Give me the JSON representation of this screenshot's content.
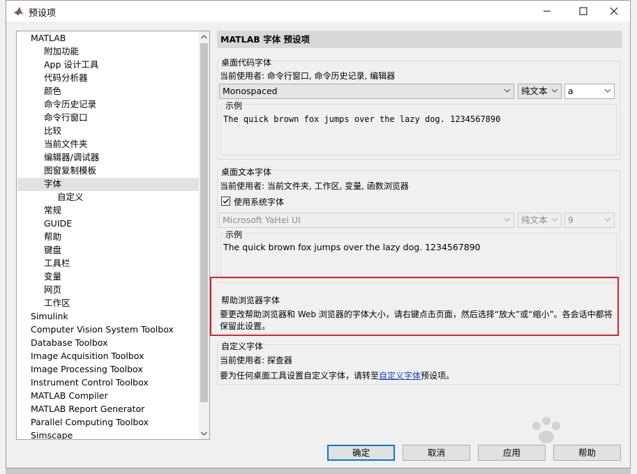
{
  "window": {
    "title": "预设项"
  },
  "tree": {
    "items": [
      {
        "label": "MATLAB",
        "level": 0
      },
      {
        "label": "附加功能",
        "level": 1
      },
      {
        "label": "App 设计工具",
        "level": 1
      },
      {
        "label": "代码分析器",
        "level": 1
      },
      {
        "label": "颜色",
        "level": 1
      },
      {
        "label": "命令历史记录",
        "level": 1
      },
      {
        "label": "命令行窗口",
        "level": 1
      },
      {
        "label": "比较",
        "level": 1
      },
      {
        "label": "当前文件夹",
        "level": 1
      },
      {
        "label": "编辑器/调试器",
        "level": 1
      },
      {
        "label": "图窗复制模板",
        "level": 1
      },
      {
        "label": "字体",
        "level": 1,
        "selected": true
      },
      {
        "label": "自定义",
        "level": 2
      },
      {
        "label": "常规",
        "level": 1
      },
      {
        "label": "GUIDE",
        "level": 1
      },
      {
        "label": "帮助",
        "level": 1
      },
      {
        "label": "键盘",
        "level": 1
      },
      {
        "label": "工具栏",
        "level": 1
      },
      {
        "label": "变量",
        "level": 1
      },
      {
        "label": "网页",
        "level": 1
      },
      {
        "label": "工作区",
        "level": 1
      },
      {
        "label": "Simulink",
        "level": 0
      },
      {
        "label": "Computer Vision System Toolbox",
        "level": 0
      },
      {
        "label": "Database Toolbox",
        "level": 0
      },
      {
        "label": "Image Acquisition Toolbox",
        "level": 0
      },
      {
        "label": "Image Processing Toolbox",
        "level": 0
      },
      {
        "label": "Instrument Control Toolbox",
        "level": 0
      },
      {
        "label": "MATLAB Compiler",
        "level": 0
      },
      {
        "label": "MATLAB Report Generator",
        "level": 0
      },
      {
        "label": "Parallel Computing Toolbox",
        "level": 0
      },
      {
        "label": "Simscape",
        "level": 0
      }
    ]
  },
  "panel": {
    "title": "MATLAB 字体 预设项",
    "code_font": {
      "title": "桌面代码字体",
      "used_by": "当前使用者: 命令行窗口, 命令历史记录, 编辑器",
      "font_name": "Monospaced",
      "style": "纯文本",
      "size": "a",
      "sample_title": "示例",
      "sample_text": "The quick brown fox jumps over the lazy dog.  1234567890"
    },
    "text_font": {
      "title": "桌面文本字体",
      "used_by": "当前使用者: 当前文件夹, 工作区, 变量, 函数浏览器",
      "use_system_label": "使用系统字体",
      "use_system_checked": true,
      "font_name": "Microsoft YaHei UI",
      "style": "纯文本",
      "size": "9",
      "sample_title": "示例",
      "sample_text": "The quick brown fox jumps over the lazy dog.  1234567890"
    },
    "help_font": {
      "title": "帮助浏览器字体",
      "line1": "要更改帮助浏览器和 Web 浏览器的字体大小，请右键点击页面，然后选择“放大”或“缩小”。各会话中都将",
      "line2": "保留此设置。"
    },
    "custom_font": {
      "title": "自定义字体",
      "used_by": "当前使用者: 探查器",
      "desc_before": "要为任何桌面工具设置自定义字体，请转至",
      "link": "自定义字体",
      "desc_after": "预设项。"
    }
  },
  "buttons": {
    "ok": "确定",
    "cancel": "取消",
    "apply": "应用",
    "help": "帮助"
  },
  "colors": {
    "highlight": "#e0202a",
    "link": "#1a3fbf",
    "primary_border": "#0078d7"
  }
}
